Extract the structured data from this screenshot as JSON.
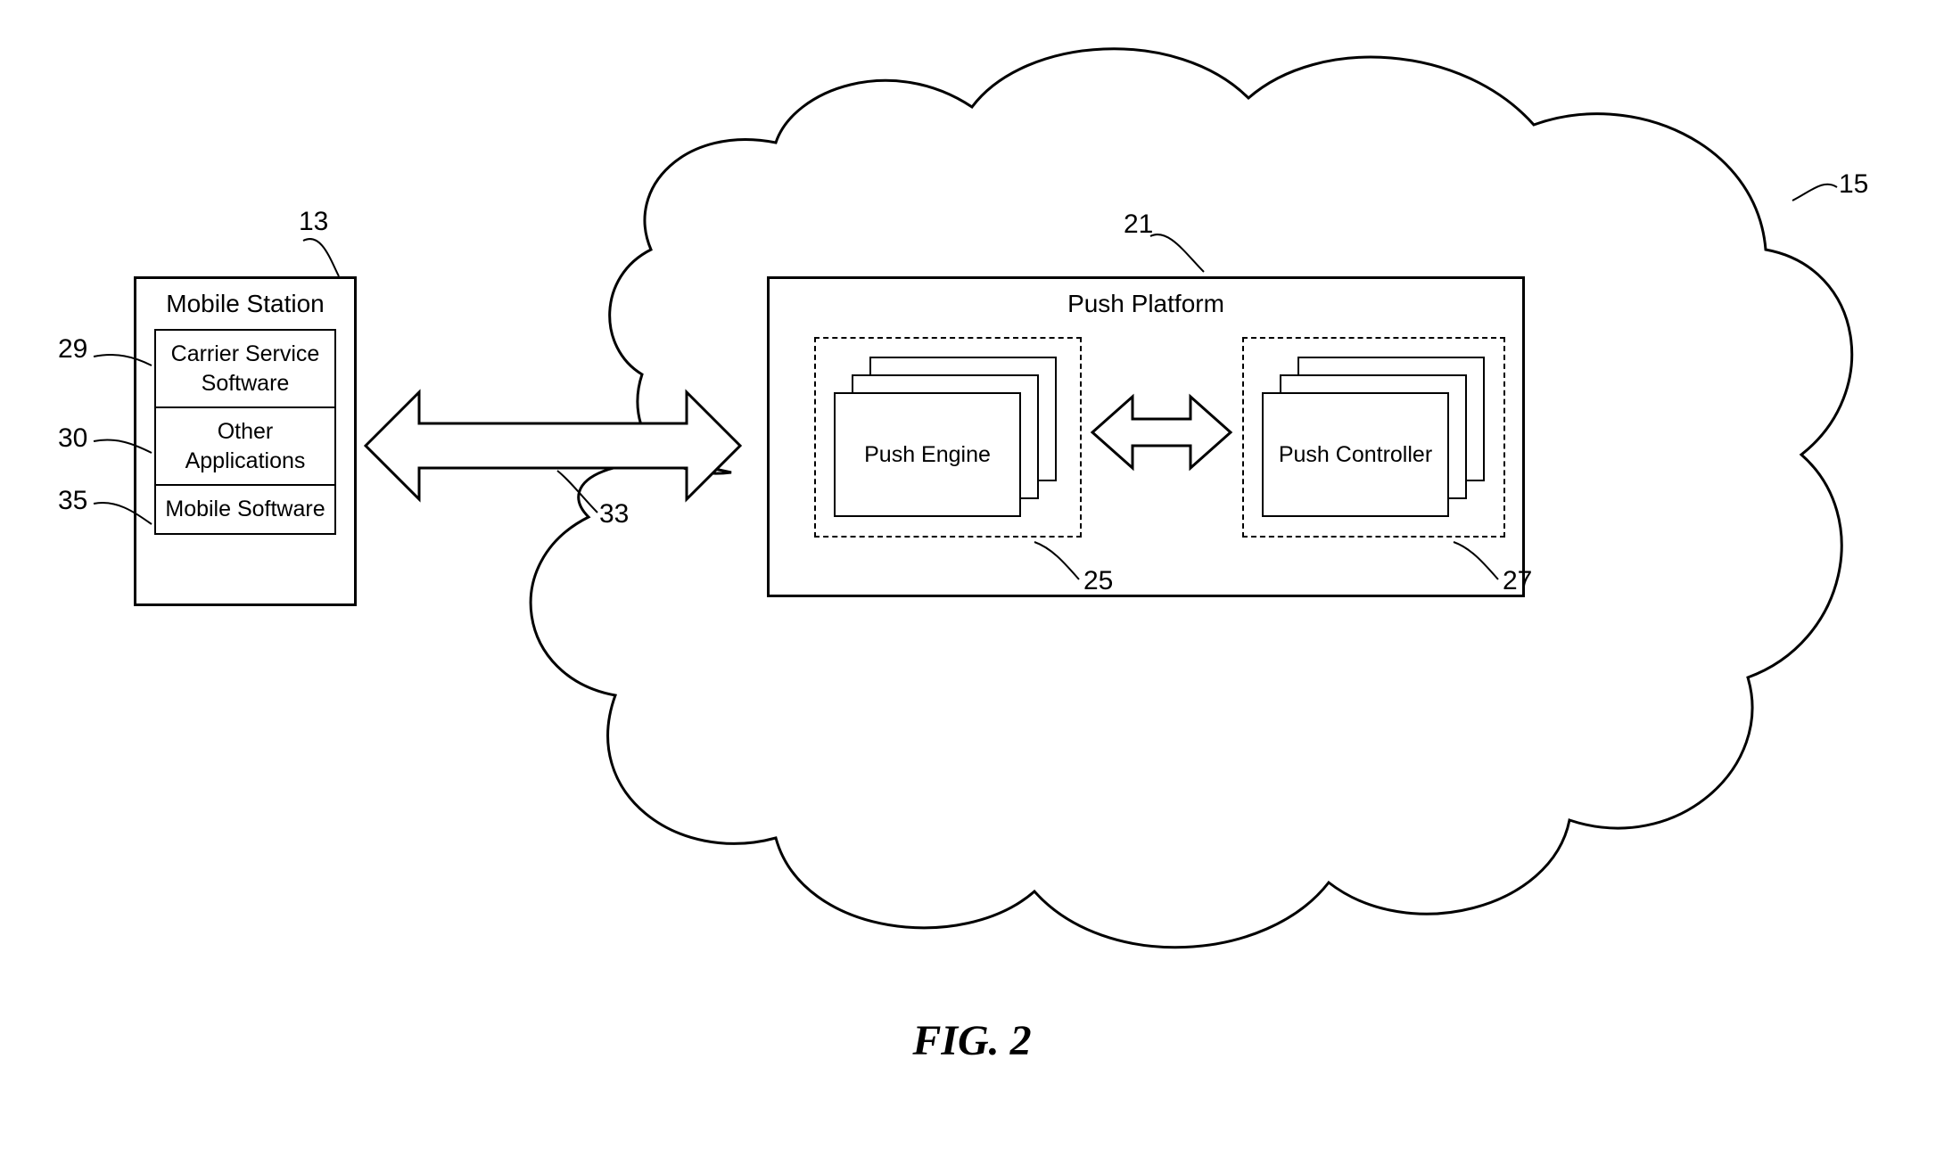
{
  "mobileStation": {
    "title": "Mobile Station",
    "carrier": "Carrier Service Software",
    "other": "Other Applications",
    "mobile": "Mobile Software"
  },
  "pushPlatform": {
    "title": "Push Platform",
    "engine": "Push Engine",
    "controller": "Push Controller"
  },
  "refs": {
    "r13": "13",
    "r15": "15",
    "r21": "21",
    "r25": "25",
    "r27": "27",
    "r29": "29",
    "r30": "30",
    "r33": "33",
    "r35": "35"
  },
  "caption": "FIG. 2"
}
